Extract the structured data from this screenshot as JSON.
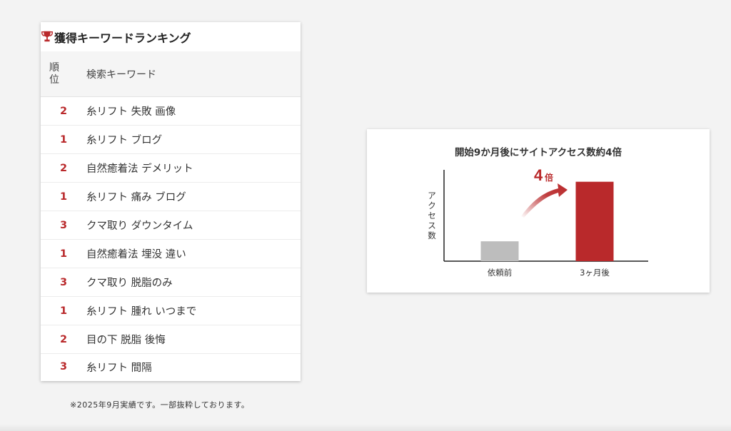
{
  "ranking": {
    "title": "獲得キーワードランキング",
    "columns": {
      "rank": "順\n位",
      "keyword": "検索キーワード"
    },
    "rows": [
      {
        "rank": "2",
        "keyword": "糸リフト 失敗 画像"
      },
      {
        "rank": "1",
        "keyword": "糸リフト ブログ"
      },
      {
        "rank": "2",
        "keyword": "自然癒着法 デメリット"
      },
      {
        "rank": "1",
        "keyword": "糸リフト 痛み ブログ"
      },
      {
        "rank": "3",
        "keyword": "クマ取り ダウンタイム"
      },
      {
        "rank": "1",
        "keyword": "自然癒着法 埋没 違い"
      },
      {
        "rank": "3",
        "keyword": "クマ取り 脱脂のみ"
      },
      {
        "rank": "1",
        "keyword": "糸リフト 腫れ いつまで"
      },
      {
        "rank": "2",
        "keyword": "目の下 脱脂 後悔"
      },
      {
        "rank": "3",
        "keyword": "糸リフト 間隔"
      }
    ],
    "note": "※2025年9月実績です。一部抜粋しております。"
  },
  "colors": {
    "accent": "#b9292b",
    "before_bar": "#bdbdbd"
  },
  "chart_data": {
    "type": "bar",
    "title": "開始9か月後にサイトアクセス数約4倍",
    "ylabel": "アクセス数",
    "categories": [
      "依頼前",
      "3ヶ月後"
    ],
    "values": [
      1,
      4
    ],
    "ylim": [
      0,
      4.6
    ],
    "annotation": {
      "value": "4",
      "unit": "倍"
    },
    "grid": false
  }
}
